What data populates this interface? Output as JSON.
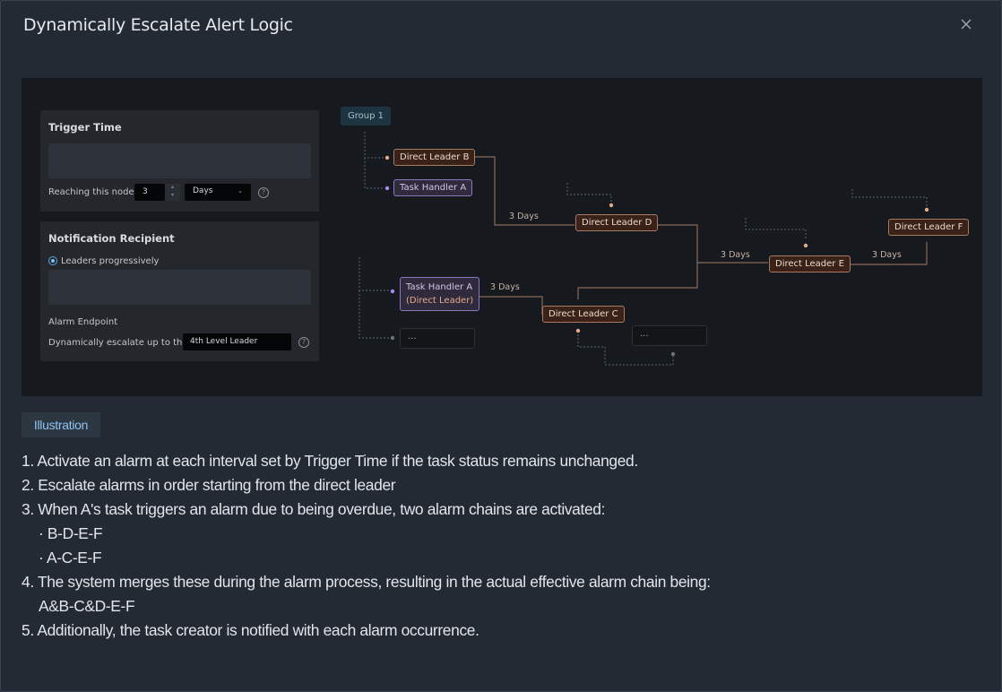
{
  "dialog": {
    "title": "Dynamically Escalate Alert Logic",
    "close_icon": "close-icon"
  },
  "illustration": {
    "trigger_card": {
      "title": "Trigger Time",
      "reaching_label": "Reaching this node",
      "number_value": "3",
      "unit_value": "Days",
      "help_icon": "question-circle-icon"
    },
    "recipient_card": {
      "title": "Notification Recipient",
      "radio_label": "Leaders progressively",
      "endpoint_label": "Alarm Endpoint",
      "escalate_label": "Dynamically escalate up to the",
      "escalate_value": "4th Level Leader",
      "help_icon": "question-circle-icon"
    },
    "diagram": {
      "group": "Group 1",
      "nodes": {
        "leader_b": "Direct Leader B",
        "handler_a": "Task Handler A",
        "leader_d": "Direct Leader D",
        "leader_e": "Direct Leader E",
        "leader_f": "Direct Leader F",
        "handler_a2_line1": "Task Handler A",
        "handler_a2_line2": "(Direct Leader)",
        "leader_c": "Direct Leader C",
        "ellipsis1": "...",
        "ellipsis2": "..."
      },
      "edge_labels": {
        "b_to_d": "3 Days",
        "d_to_e": "3 Days",
        "e_to_f": "3 Days",
        "a_to_c": "3 Days"
      }
    }
  },
  "tag": "Illustration",
  "description": [
    "1. Activate an alarm at each interval set by Trigger Time if the task status remains unchanged.",
    "2. Escalate alarms in order starting from the direct leader",
    "3. When A's task triggers an alarm due to being overdue, two alarm chains are activated:",
    "· B-D-E-F",
    "· A-C-E-F",
    "4. The system merges these during the alarm process, resulting in the actual effective alarm chain being:",
    "A&B-C&D-E-F",
    "5. Additionally, the task creator is notified with each alarm occurrence."
  ],
  "colors": {
    "accent": "#8ec5f2",
    "leader_border": "#a87a62",
    "handler_border": "#8c78c2"
  }
}
